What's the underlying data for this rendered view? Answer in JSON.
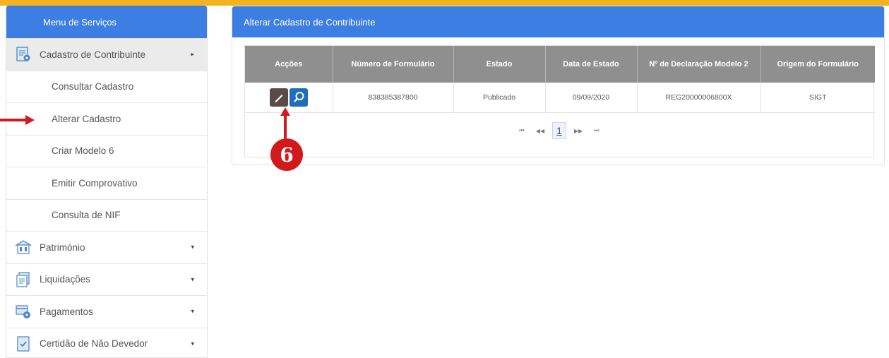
{
  "colors": {
    "brand_blue": "#3d7ee3",
    "header_gray": "#8f8f8f",
    "accent_yellow": "#f3b321",
    "annotation_red": "#d2191b"
  },
  "sidebar": {
    "title": "Menu de Serviços",
    "items": [
      {
        "label": "Cadastro de Contribuinte",
        "icon": "form-icon",
        "caret": "▸",
        "expanded": true,
        "children": [
          "Consultar Cadastro",
          "Alterar Cadastro",
          "Criar Modelo 6",
          "Emitir Comprovativo",
          "Consulta de NIF"
        ]
      },
      {
        "label": "Património",
        "icon": "building-icon",
        "caret": "▾"
      },
      {
        "label": "Liquidações",
        "icon": "document-stack-icon",
        "caret": "▾"
      },
      {
        "label": "Pagamentos",
        "icon": "payment-icon",
        "caret": "▾"
      },
      {
        "label": "Certidão de Não Devedor",
        "icon": "certificate-icon",
        "caret": "▾"
      }
    ]
  },
  "panel": {
    "title": "Alterar Cadastro de Contribuinte",
    "columns": [
      "Acções",
      "Número de Formulário",
      "Estado",
      "Data de Estado",
      "Nº de Declaração Modelo 2",
      "Origem do Formulário"
    ],
    "rows": [
      {
        "form_number": "838385387800",
        "status": "Publicado",
        "status_date": "09/09/2020",
        "declaration_number": "REG20000006800X",
        "origin": "SIGT"
      }
    ],
    "pager": {
      "first": "⏮",
      "prev": "◀◀",
      "current": "1",
      "next": "▶▶",
      "last": "⏭"
    }
  },
  "annotation": {
    "step_number": "6"
  }
}
